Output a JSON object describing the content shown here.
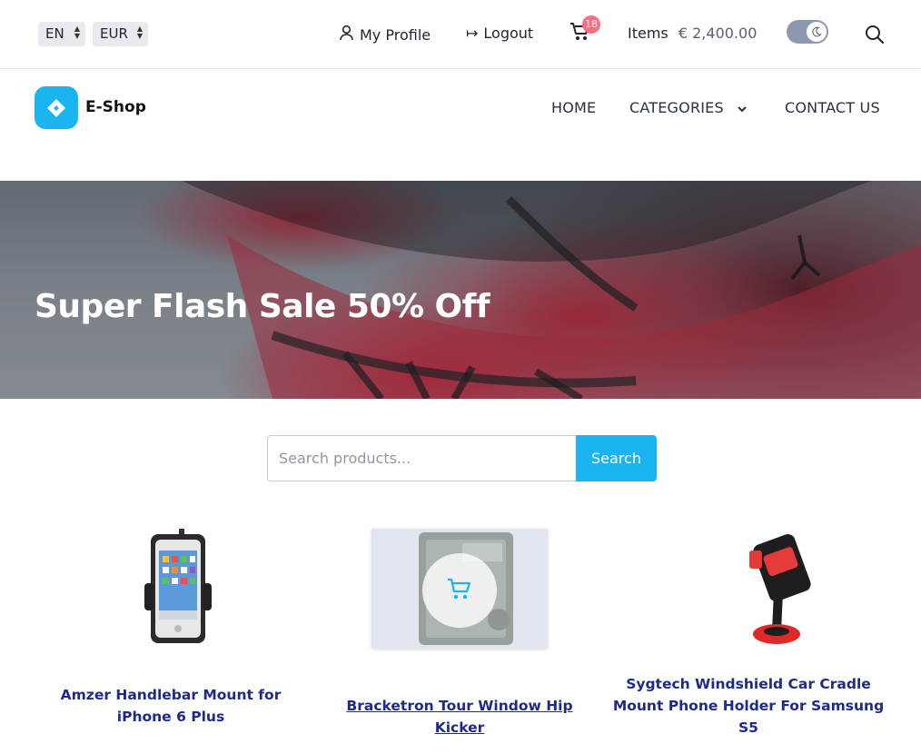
{
  "topbar": {
    "language": "EN",
    "currency": "EUR",
    "profile_label": "My Profile",
    "logout_label": "Logout",
    "cart_count": "18",
    "items_label": "Items",
    "items_total": "€ 2,400.00"
  },
  "header": {
    "brand": "E-Shop",
    "nav": {
      "home": "HOME",
      "categories": "CATEGORIES",
      "contact": "CONTACT US"
    }
  },
  "hero": {
    "title": "Super Flash Sale 50% Off"
  },
  "search": {
    "placeholder": "Search products...",
    "button": "Search"
  },
  "products": [
    {
      "title": "Amzer Handlebar Mount for iPhone 6 Plus"
    },
    {
      "title": "Bracketron Tour Window Hip Kicker"
    },
    {
      "title": "Sygtech Windshield Car Cradle Mount Phone Holder For Samsung S5"
    }
  ],
  "colors": {
    "accent": "#1ab5f0",
    "badge": "#ff6b81",
    "product_title": "#1d2a8c"
  }
}
